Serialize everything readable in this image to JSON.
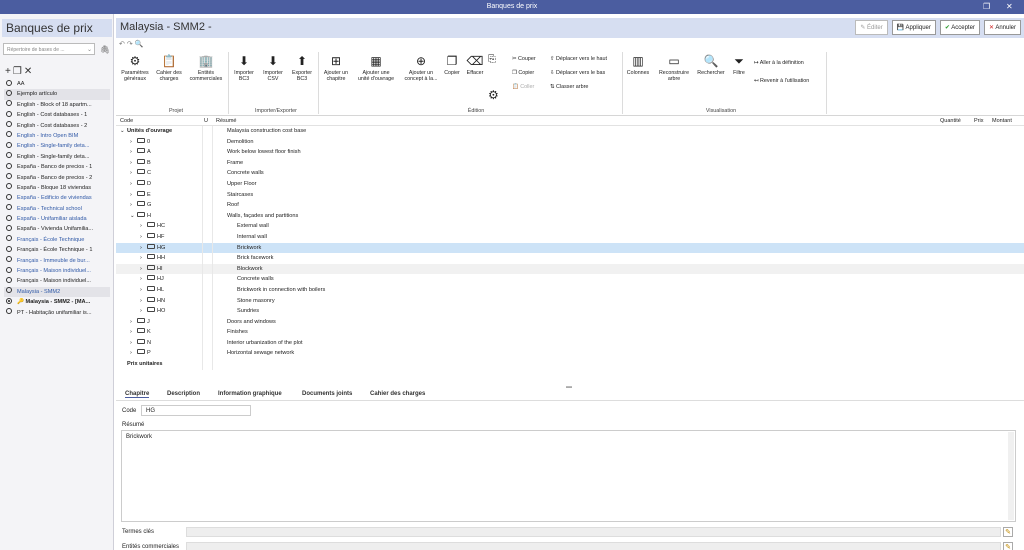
{
  "window": {
    "title": "Banques de prix",
    "restore_glyph": "❐",
    "close_glyph": "✕"
  },
  "left": {
    "header": "Banques de prix",
    "repo_placeholder": "Répertoire de bases de ...",
    "databases": [
      {
        "label": "AA",
        "style": "normal"
      },
      {
        "label": "Ejemplo artículo",
        "style": "alt"
      },
      {
        "label": "English - Block of 18 apartm...",
        "style": "normal"
      },
      {
        "label": "English - Cost databases - 1",
        "style": "normal"
      },
      {
        "label": "English - Cost databases - 2",
        "style": "normal"
      },
      {
        "label": "English - Intro Open BIM",
        "style": "blue"
      },
      {
        "label": "English - Single-family deta...",
        "style": "blue"
      },
      {
        "label": "English - Single-family deta...",
        "style": "normal"
      },
      {
        "label": "España - Banco de precios - 1",
        "style": "normal"
      },
      {
        "label": "España - Banco de precios - 2",
        "style": "normal"
      },
      {
        "label": "España - Bloque 18 viviendas",
        "style": "normal"
      },
      {
        "label": "España - Edificio de viviendas",
        "style": "blue"
      },
      {
        "label": "España - Technical school",
        "style": "blue"
      },
      {
        "label": "España - Unifamiliar aislada",
        "style": "blue"
      },
      {
        "label": "España - Vivienda Unifamilia...",
        "style": "normal"
      },
      {
        "label": "Français - École Technique",
        "style": "blue"
      },
      {
        "label": "Français - École Technique - 1",
        "style": "normal"
      },
      {
        "label": "Français - Immeuble de bur...",
        "style": "blue"
      },
      {
        "label": "Français - Maison individuel...",
        "style": "blue"
      },
      {
        "label": "Français - Maison individuel...",
        "style": "normal"
      },
      {
        "label": "Malaysia - SMM2",
        "style": "blue-alt"
      },
      {
        "label": "Malaysia - SMM2 - [MA...",
        "style": "bold",
        "selected": true
      },
      {
        "label": "PT - Habitação unifamiliar is...",
        "style": "normal"
      }
    ]
  },
  "main": {
    "title": "Malaysia - SMM2 -",
    "buttons": {
      "edit": "Éditer",
      "apply": "Appliquer",
      "accept": "Accepter",
      "cancel": "Annuler"
    }
  },
  "ribbon": {
    "params": "Paramètres\ngénéraux",
    "specs": "Cahier des\ncharges",
    "entities": "Entités\ncommerciales",
    "import_bc3": "Importer\nBC3",
    "import_csv": "Importer\nCSV",
    "export_bc3": "Exporter\nBC3",
    "add_chapter": "Ajouter un\nchapitre",
    "add_unit": "Ajouter une\nunité d'ouvrage",
    "add_concept": "Ajouter un\nconcept à la...",
    "copy_big": "Copier",
    "erase": "Effacer",
    "cut": "Couper",
    "copy_small": "Copier",
    "paste": "Coller",
    "move_up": "Déplacer vers le haut",
    "move_down": "Déplacer vers le bas",
    "sort_tree": "Classer arbre",
    "columns": "Colonnes",
    "rebuild": "Reconstruire\narbre",
    "search": "Rechercher",
    "filter": "Filtre",
    "goto_def": "Aller à la définition",
    "back_use": "Revenir à l'utilisation",
    "grp_project": "Projet",
    "grp_import": "Importer/Exporter",
    "grp_edition": "Édition",
    "grp_view": "Visualisation"
  },
  "table": {
    "headers": {
      "code": "Code",
      "u": "U",
      "resume": "Résumé",
      "qty": "Quantité",
      "price": "Prix",
      "amount": "Montant"
    },
    "rows": [
      {
        "level": 0,
        "exp": "⌄",
        "code": "Unités d'ouvrage",
        "resume": "Malaysia construction cost base",
        "folder": false
      },
      {
        "level": 1,
        "exp": "›",
        "code": "0",
        "resume": "Demolition",
        "folder": true
      },
      {
        "level": 1,
        "exp": "›",
        "code": "A",
        "resume": "Work below lowest floor finish",
        "folder": true
      },
      {
        "level": 1,
        "exp": "›",
        "code": "B",
        "resume": "Frame",
        "folder": true
      },
      {
        "level": 1,
        "exp": "›",
        "code": "C",
        "resume": "Concrete walls",
        "folder": true
      },
      {
        "level": 1,
        "exp": "›",
        "code": "D",
        "resume": "Upper Floor",
        "folder": true
      },
      {
        "level": 1,
        "exp": "›",
        "code": "E",
        "resume": "Staircases",
        "folder": true
      },
      {
        "level": 1,
        "exp": "›",
        "code": "G",
        "resume": "Roof",
        "folder": true
      },
      {
        "level": 1,
        "exp": "⌄",
        "code": "H",
        "resume": "Walls, façades and partitions",
        "folder": true
      },
      {
        "level": 2,
        "exp": "›",
        "code": "HC",
        "resume": "External wall",
        "folder": true
      },
      {
        "level": 2,
        "exp": "›",
        "code": "HF",
        "resume": "Internal wall",
        "folder": true
      },
      {
        "level": 2,
        "exp": "›",
        "code": "HG",
        "resume": "Brickwork",
        "folder": true,
        "selected": true
      },
      {
        "level": 2,
        "exp": "›",
        "code": "HH",
        "resume": "Brick facework",
        "folder": true
      },
      {
        "level": 2,
        "exp": "›",
        "code": "HI",
        "resume": "Blockwork",
        "folder": true,
        "hl": true
      },
      {
        "level": 2,
        "exp": "›",
        "code": "HJ",
        "resume": "Concrete walls",
        "folder": true
      },
      {
        "level": 2,
        "exp": "›",
        "code": "HL",
        "resume": "Brickwork in connection with boilers",
        "folder": true
      },
      {
        "level": 2,
        "exp": "›",
        "code": "HN",
        "resume": "Stone masonry",
        "folder": true
      },
      {
        "level": 2,
        "exp": "›",
        "code": "HO",
        "resume": "Sundries",
        "folder": true
      },
      {
        "level": 1,
        "exp": "›",
        "code": "J",
        "resume": "Doors and windows",
        "folder": true
      },
      {
        "level": 1,
        "exp": "›",
        "code": "K",
        "resume": "Finishes",
        "folder": true
      },
      {
        "level": 1,
        "exp": "›",
        "code": "N",
        "resume": "Interior urbanization of the plot",
        "folder": true
      },
      {
        "level": 1,
        "exp": "›",
        "code": "P",
        "resume": "Horizontal sewage network",
        "folder": true
      },
      {
        "level": 0,
        "exp": "",
        "code": "Prix unitaires",
        "resume": "",
        "folder": false
      }
    ]
  },
  "detail": {
    "tabs": [
      "Chapitre",
      "Description",
      "Information graphique",
      "Documents joints",
      "Cahier des charges"
    ],
    "code_label": "Code",
    "code_value": "HG",
    "resume_label": "Résumé",
    "resume_value": "Brickwork",
    "keywords_label": "Termes clés",
    "entities_label": "Entités commerciales"
  },
  "colors": {
    "titlebar": "#4b5da0",
    "header": "#d6def1",
    "selected_row": "#cde3f7",
    "link_blue": "#2f58a6"
  },
  "icons": [
    "gear-icon",
    "document-icon",
    "building-icon",
    "import-icon",
    "export-icon",
    "folder-icon",
    "search-icon",
    "filter-icon",
    "pencil-icon",
    "plus-icon",
    "close-icon"
  ]
}
